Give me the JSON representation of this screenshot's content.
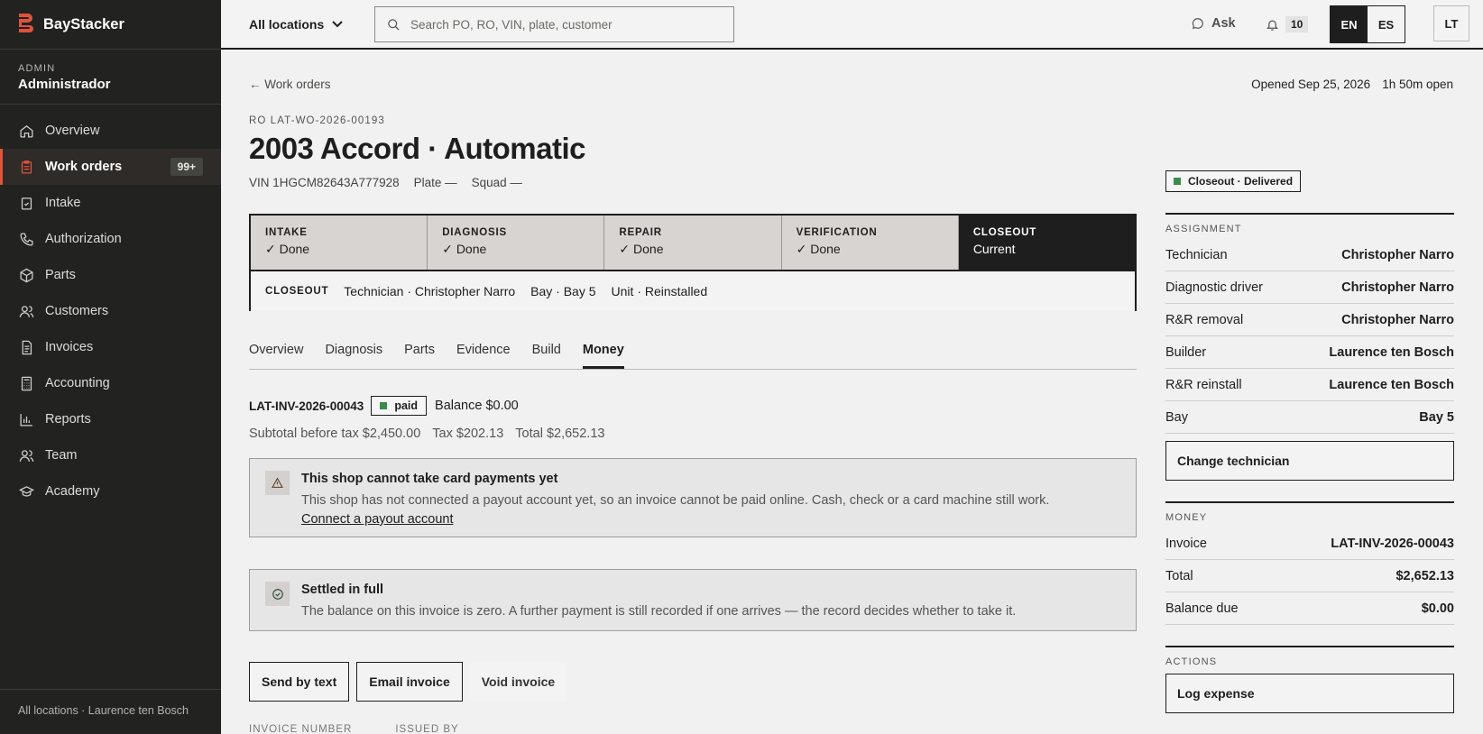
{
  "brand": {
    "name": "BayStacker",
    "accent": "#e0533a"
  },
  "user": {
    "role": "ADMIN",
    "name": "Administrador"
  },
  "nav": [
    {
      "label": "Overview",
      "icon": "home-icon"
    },
    {
      "label": "Work orders",
      "icon": "clipboard-icon",
      "active": true,
      "badge": "99+"
    },
    {
      "label": "Intake",
      "icon": "clipboard-check-icon"
    },
    {
      "label": "Authorization",
      "icon": "phone-icon"
    },
    {
      "label": "Parts",
      "icon": "box-icon"
    },
    {
      "label": "Customers",
      "icon": "users-icon"
    },
    {
      "label": "Invoices",
      "icon": "document-icon"
    },
    {
      "label": "Accounting",
      "icon": "calculator-icon"
    },
    {
      "label": "Reports",
      "icon": "bar-chart-icon"
    },
    {
      "label": "Team",
      "icon": "team-icon"
    },
    {
      "label": "Academy",
      "icon": "graduation-cap-icon"
    }
  ],
  "sidebar_footer": "All locations · Laurence ten Bosch",
  "topbar": {
    "location": "All locations",
    "search_placeholder": "Search PO, RO, VIN, plate, customer",
    "ask": "Ask",
    "notifications": "10",
    "lang_en": "EN",
    "lang_es": "ES",
    "avatar": "LT"
  },
  "page": {
    "back": "← Work orders",
    "opened": "Opened Sep 25, 2026",
    "open_duration": "1h 50m open",
    "ro": "RO LAT-WO-2026-00193",
    "title": "2003 Accord · Automatic",
    "vin": "VIN 1HGCM82643A777928",
    "plate": "Plate —",
    "squad": "Squad —"
  },
  "stages": [
    {
      "label": "INTAKE",
      "value": "✓ Done"
    },
    {
      "label": "DIAGNOSIS",
      "value": "✓ Done"
    },
    {
      "label": "REPAIR",
      "value": "✓ Done"
    },
    {
      "label": "VERIFICATION",
      "value": "✓ Done"
    },
    {
      "label": "CLOSEOUT",
      "value": "Current"
    }
  ],
  "closeout": {
    "label": "CLOSEOUT",
    "technician": "Technician · Christopher Narro",
    "bay": "Bay · Bay 5",
    "unit": "Unit · Reinstalled"
  },
  "tabs": [
    "Overview",
    "Diagnosis",
    "Parts",
    "Evidence",
    "Build",
    "Money"
  ],
  "invoice": {
    "number": "LAT-INV-2026-00043",
    "status": "paid",
    "balance": "Balance $0.00",
    "subtotal": "Subtotal before tax $2,450.00",
    "tax": "Tax $202.13",
    "total": "Total $2,652.13"
  },
  "alert_payout": {
    "title": "This shop cannot take card payments yet",
    "body": "This shop has not connected a payout account yet, so an invoice cannot be paid online. Cash, check or a card machine still work.",
    "link": "Connect a payout account"
  },
  "alert_settled": {
    "title": "Settled in full",
    "body": "The balance on this invoice is zero. A further payment is still recorded if one arrives — the record decides whether to take it."
  },
  "actions": {
    "send_text": "Send by text",
    "email": "Email invoice",
    "void": "Void invoice"
  },
  "cut_headers": [
    "INVOICE NUMBER",
    "ISSUED BY"
  ],
  "right": {
    "status": "Closeout · Delivered",
    "assignment_title": "ASSIGNMENT",
    "assignment": [
      {
        "k": "Technician",
        "v": "Christopher Narro"
      },
      {
        "k": "Diagnostic driver",
        "v": "Christopher Narro"
      },
      {
        "k": "R&R removal",
        "v": "Christopher Narro"
      },
      {
        "k": "Builder",
        "v": "Laurence ten Bosch"
      },
      {
        "k": "R&R reinstall",
        "v": "Laurence ten Bosch"
      },
      {
        "k": "Bay",
        "v": "Bay 5"
      }
    ],
    "change_tech": "Change technician",
    "money_title": "MONEY",
    "money": [
      {
        "k": "Invoice",
        "v": "LAT-INV-2026-00043"
      },
      {
        "k": "Total",
        "v": "$2,652.13"
      },
      {
        "k": "Balance due",
        "v": "$0.00"
      }
    ],
    "actions_title": "ACTIONS",
    "log_expense": "Log expense"
  },
  "colors": {
    "sidebar": "#222221",
    "paid_green": "#3b8b4b",
    "stage_done": "#d8d4d2"
  }
}
